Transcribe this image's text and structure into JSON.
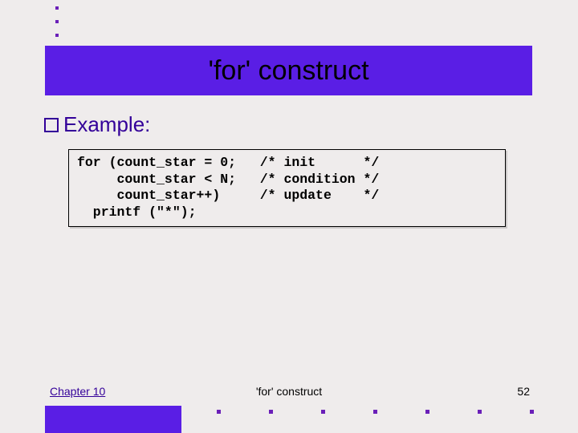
{
  "title": "'for' construct",
  "bullet_label": "Example:",
  "code": {
    "line1": "for (count_star = 0;   /* init      */",
    "line2": "     count_star < N;   /* condition */",
    "line3": "     count_star++)     /* update    */",
    "line4": "  printf (\"*\");"
  },
  "footer": {
    "chapter": "Chapter 10",
    "center": "'for' construct",
    "page": "52"
  }
}
